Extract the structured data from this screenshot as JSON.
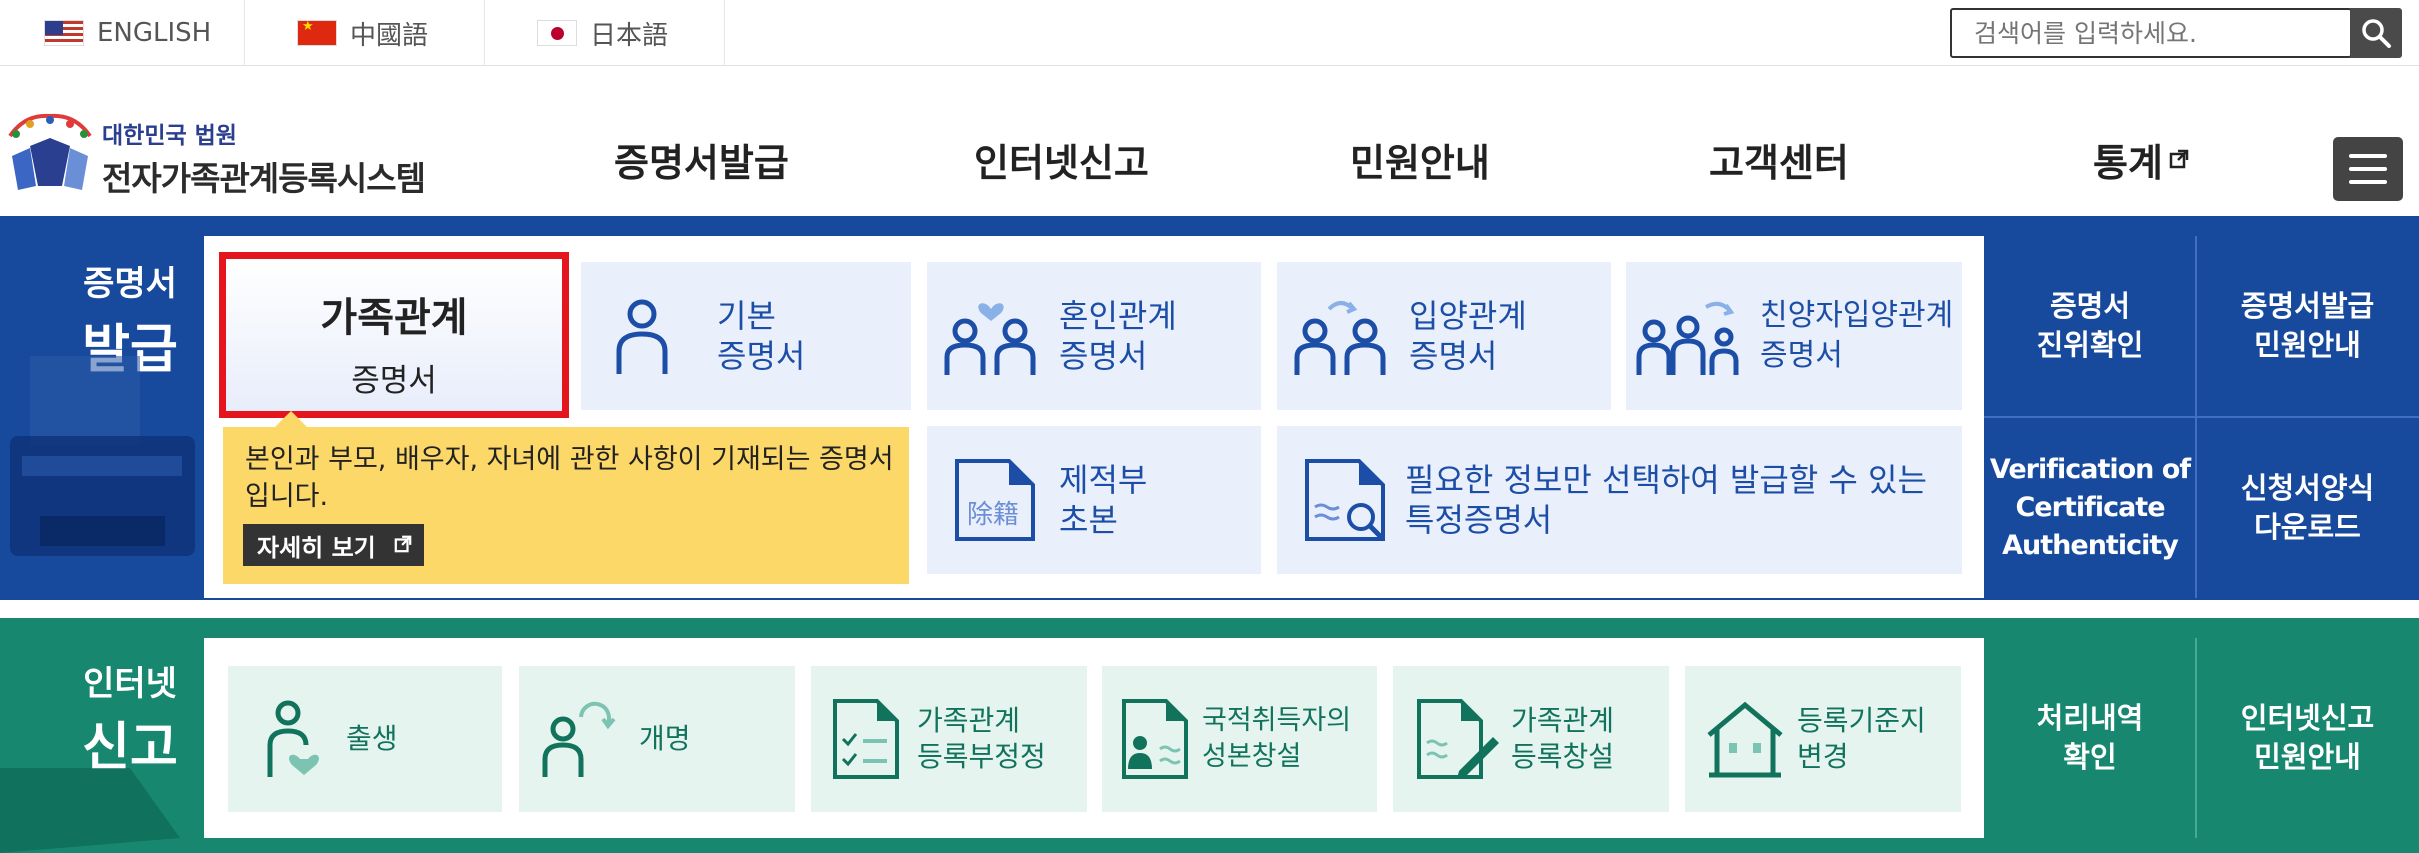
{
  "topbar": {
    "languages": [
      {
        "label": "ENGLISH",
        "flag": "us-flag-icon"
      },
      {
        "label": "中國語",
        "flag": "cn-flag-icon"
      },
      {
        "label": "日本語",
        "flag": "jp-flag-icon"
      }
    ],
    "search_placeholder": "검색어를 입력하세요."
  },
  "header": {
    "logo_sub": "대한민국 법원",
    "logo_main": "전자가족관계등록시스템",
    "nav": [
      "증명서발급",
      "인터넷신고",
      "민원안내",
      "고객센터",
      "통계"
    ]
  },
  "cert": {
    "title_small": "증명서",
    "title_big": "발급",
    "active_card": {
      "line1": "가족관계",
      "line2": "증명서"
    },
    "cards": [
      {
        "line1": "기본",
        "line2": "증명서"
      },
      {
        "line1": "혼인관계",
        "line2": "증명서"
      },
      {
        "line1": "입양관계",
        "line2": "증명서"
      },
      {
        "line1": "친양자입양관계",
        "line2": "증명서"
      },
      {
        "line1": "제적부",
        "line2": "초본"
      },
      {
        "line1": "필요한 정보만 선택하여 발급할 수 있는",
        "line2": "특정증명서"
      }
    ],
    "tooltip_text": "본인과 부모, 배우자, 자녀에 관한 사항이 기재되는 증명서입니다.",
    "tooltip_more": "자세히 보기",
    "stamp_text": "除籍",
    "side": [
      {
        "line1": "증명서",
        "line2": "진위확인"
      },
      {
        "line1": "증명서발급",
        "line2": "민원안내"
      },
      {
        "line1": "Verification of",
        "line2": "Certificate",
        "line3": "Authenticity"
      },
      {
        "line1": "신청서양식",
        "line2": "다운로드"
      }
    ]
  },
  "report": {
    "title_small": "인터넷",
    "title_big": "신고",
    "cards": [
      {
        "line1": "출생",
        "line2": ""
      },
      {
        "line1": "개명",
        "line2": ""
      },
      {
        "line1": "가족관계",
        "line2": "등록부정정"
      },
      {
        "line1": "국적취득자의",
        "line2": "성본창설"
      },
      {
        "line1": "가족관계",
        "line2": "등록창설"
      },
      {
        "line1": "등록기준지",
        "line2": "변경"
      }
    ],
    "side": [
      {
        "line1": "처리내역",
        "line2": "확인"
      },
      {
        "line1": "인터넷신고",
        "line2": "민원안내"
      }
    ]
  }
}
